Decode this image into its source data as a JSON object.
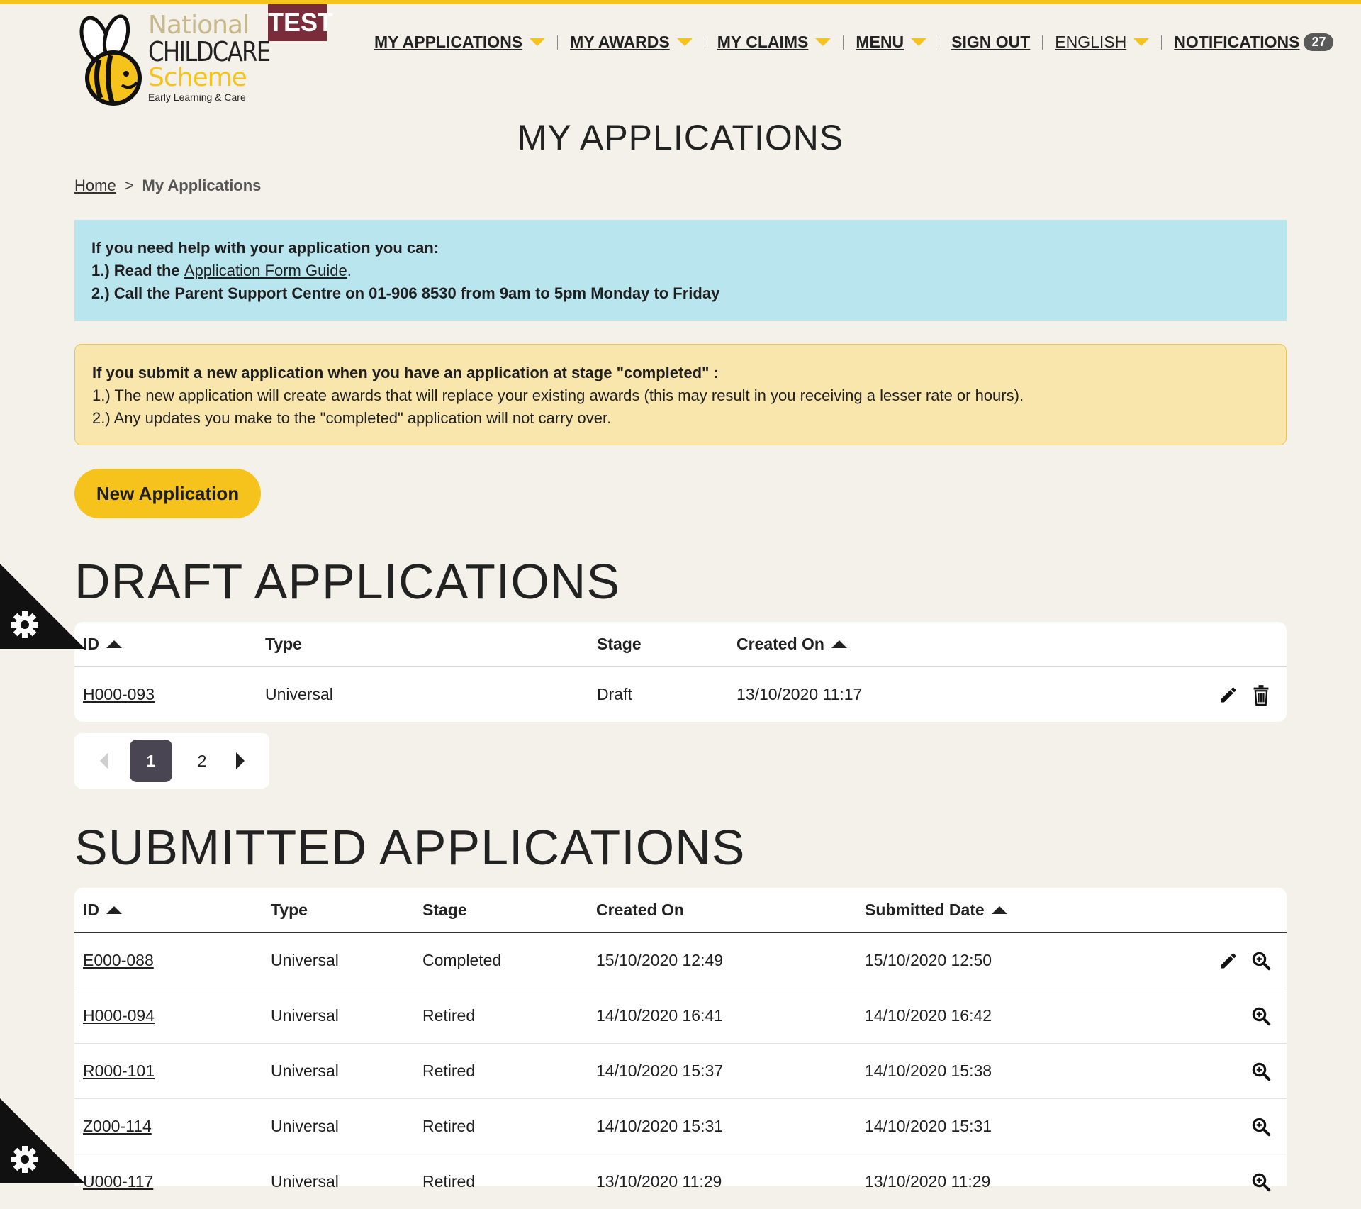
{
  "environment_badge": "TEST",
  "logo": {
    "line1": "National",
    "line2": "CHILDCARE",
    "line3": "Scheme",
    "line4": "Early Learning & Care"
  },
  "nav": {
    "my_applications": "MY APPLICATIONS",
    "my_awards": "MY AWARDS",
    "my_claims": "MY CLAIMS",
    "menu": "MENU",
    "sign_out": "SIGN OUT",
    "language": "ENGLISH",
    "notifications": "NOTIFICATIONS",
    "notifications_count": "27"
  },
  "page_title": "MY APPLICATIONS",
  "breadcrumb": {
    "home": "Home",
    "separator": ">",
    "current": "My Applications"
  },
  "info_box": {
    "heading": "If you need help with your application you can:",
    "line1_prefix": "1.)  Read the ",
    "line1_link": "Application Form Guide",
    "line1_suffix": ".",
    "line2": "2.)  Call the Parent Support Centre on  01-906 8530 from 9am to 5pm Monday to Friday"
  },
  "warning_box": {
    "heading": "If you submit a new application when you have an application at stage \"completed\" :",
    "line1": "1.) The new application will create awards that will replace your existing awards (this may result in you receiving a lesser rate or hours).",
    "line2": "2.) Any updates you make to the \"completed\" application will not carry over."
  },
  "new_application_button": "New Application",
  "draft": {
    "title": "DRAFT APPLICATIONS",
    "headers": {
      "id": "ID",
      "type": "Type",
      "stage": "Stage",
      "created_on": "Created On"
    },
    "rows": [
      {
        "id": "H000-093",
        "type": "Universal",
        "stage": "Draft",
        "created_on": "13/10/2020 11:17"
      }
    ]
  },
  "pagination": {
    "page1": "1",
    "page2": "2",
    "current": 1
  },
  "submitted": {
    "title": "SUBMITTED APPLICATIONS",
    "headers": {
      "id": "ID",
      "type": "Type",
      "stage": "Stage",
      "created_on": "Created On",
      "submitted_date": "Submitted Date"
    },
    "rows": [
      {
        "id": "E000-088",
        "type": "Universal",
        "stage": "Completed",
        "created_on": "15/10/2020 12:49",
        "submitted": "15/10/2020 12:50",
        "editable": true
      },
      {
        "id": "H000-094",
        "type": "Universal",
        "stage": "Retired",
        "created_on": "14/10/2020 16:41",
        "submitted": "14/10/2020 16:42",
        "editable": false
      },
      {
        "id": "R000-101",
        "type": "Universal",
        "stage": "Retired",
        "created_on": "14/10/2020 15:37",
        "submitted": "14/10/2020 15:38",
        "editable": false
      },
      {
        "id": "Z000-114",
        "type": "Universal",
        "stage": "Retired",
        "created_on": "14/10/2020 15:31",
        "submitted": "14/10/2020 15:31",
        "editable": false
      },
      {
        "id": "U000-117",
        "type": "Universal",
        "stage": "Retired",
        "created_on": "13/10/2020 11:29",
        "submitted": "13/10/2020 11:29",
        "editable": false
      }
    ]
  },
  "icons": {
    "edit": "pencil-icon",
    "delete": "trash-icon",
    "view": "zoom-icon",
    "settings": "gear-icon"
  },
  "colors": {
    "accent": "#f6c21c",
    "info_bg": "#b8e5ee",
    "warning_bg": "#f8e6ad",
    "badge_bg": "#7b2c3a",
    "pager_active": "#4a4553",
    "page_bg": "#f4f1ea"
  }
}
